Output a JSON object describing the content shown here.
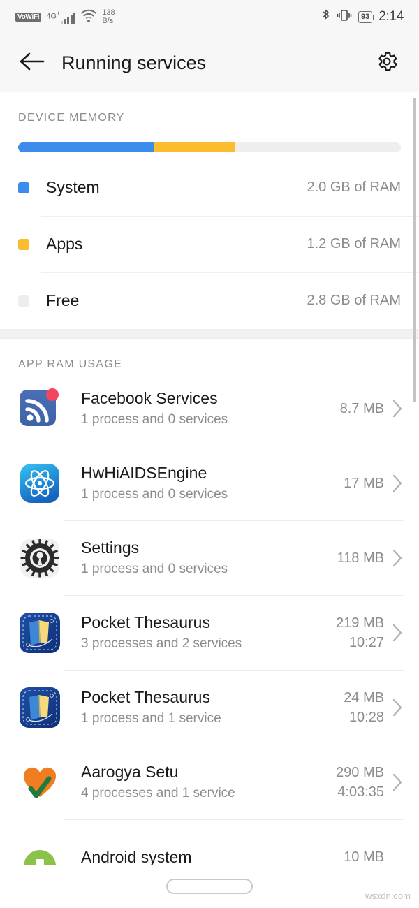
{
  "status_bar": {
    "vowifi_label": "VoWiFi",
    "network_label": "4G",
    "network_plus": "+",
    "data_speed_value": "138",
    "data_speed_unit": "B/s",
    "battery_level": "93",
    "time": "2:14",
    "icons": [
      "vowifi-badge",
      "signal-bars-icon",
      "wifi-icon",
      "bluetooth-icon",
      "vibrate-icon",
      "battery-icon"
    ]
  },
  "app_bar": {
    "back_icon": "arrow-left-icon",
    "title": "Running services",
    "settings_icon": "gear-icon"
  },
  "device_memory": {
    "section_title": "DEVICE MEMORY",
    "bar": {
      "segments": [
        {
          "name": "System",
          "color": "#3b8ceb",
          "percent": 35.5
        },
        {
          "name": "Apps",
          "color": "#fbbc2e",
          "percent": 21.0
        },
        {
          "name": "Free",
          "color": "#eeeeee",
          "percent": 43.5
        }
      ]
    },
    "rows": [
      {
        "label": "System",
        "value": "2.0 GB of RAM",
        "color": "#3b8ceb"
      },
      {
        "label": "Apps",
        "value": "1.2 GB of RAM",
        "color": "#fbbc2e"
      },
      {
        "label": "Free",
        "value": "2.8 GB of RAM",
        "color": "#ededed"
      }
    ]
  },
  "app_ram_usage": {
    "section_title": "APP RAM USAGE",
    "rows": [
      {
        "name": "Facebook Services",
        "sub": "1 process and 0 services",
        "memory": "8.7 MB",
        "time": "",
        "icon": "facebook-services-icon"
      },
      {
        "name": "HwHiAIDSEngine",
        "sub": "1 process and 0 services",
        "memory": "17 MB",
        "time": "",
        "icon": "hwhiaidsengine-icon"
      },
      {
        "name": "Settings",
        "sub": "1 process and 0 services",
        "memory": "118 MB",
        "time": "",
        "icon": "settings-gear-icon"
      },
      {
        "name": "Pocket Thesaurus",
        "sub": "3 processes and 2 services",
        "memory": "219 MB",
        "time": "10:27",
        "icon": "pocket-thesaurus-icon"
      },
      {
        "name": "Pocket Thesaurus",
        "sub": "1 process and 1 service",
        "memory": "24 MB",
        "time": "10:28",
        "icon": "pocket-thesaurus-icon"
      },
      {
        "name": "Aarogya Setu",
        "sub": "4 processes and 1 service",
        "memory": "290 MB",
        "time": "4:03:35",
        "icon": "aarogya-setu-heart-icon"
      },
      {
        "name": "Android system",
        "sub": "",
        "memory": "10 MB",
        "time": "",
        "icon": "android-robot-icon"
      }
    ]
  },
  "navigation": {
    "pill_label": "home-gesture-pill"
  },
  "watermark": "wsxdn.com"
}
